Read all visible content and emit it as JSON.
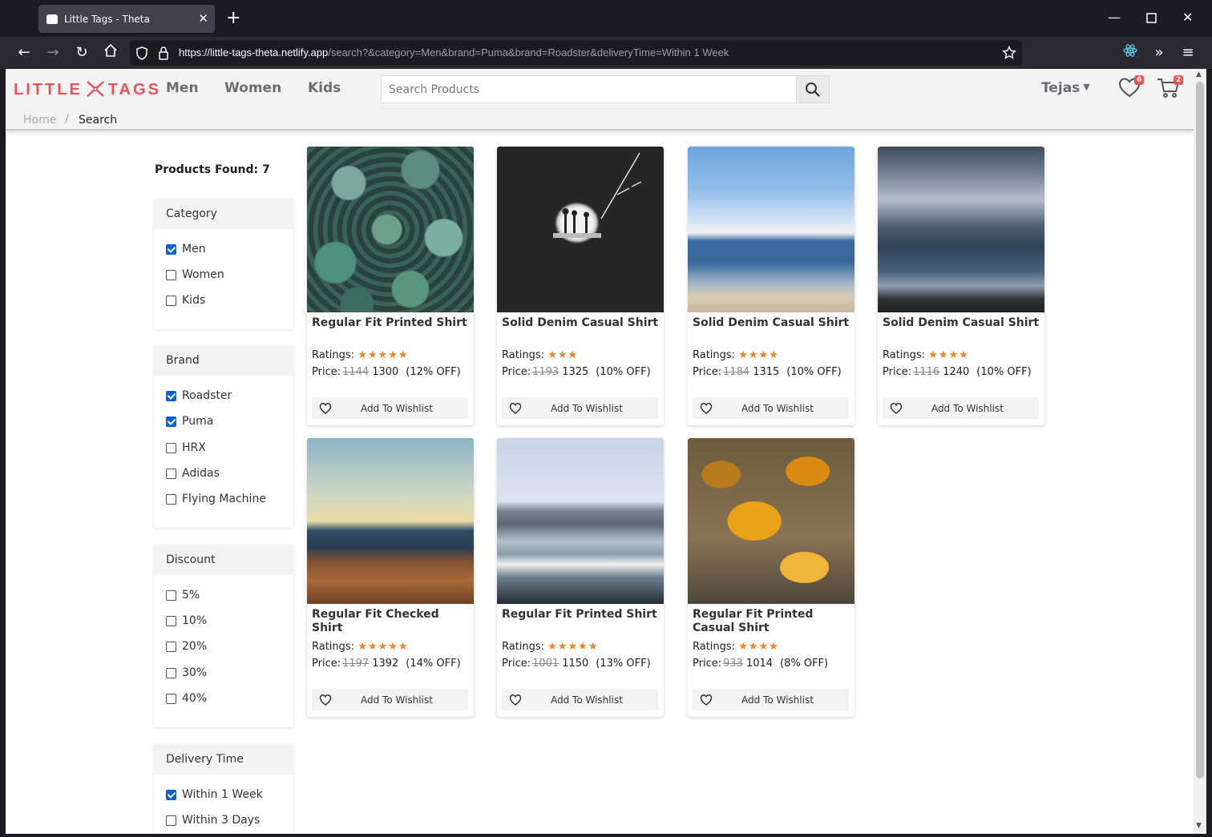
{
  "browser": {
    "tab_title": "Little Tags - Theta",
    "url_host": "https://little-tags-theta.netlify.app",
    "url_path": "/search?&category=Men&brand=Puma&brand=Roadster&deliveryTime=Within 1 Week"
  },
  "header": {
    "logo_left": "LITTLE",
    "logo_right": "TAGS",
    "nav": [
      "Men",
      "Women",
      "Kids"
    ],
    "search_placeholder": "Search Products",
    "user": "Tejas",
    "wishlist_count": "6",
    "cart_count": "2"
  },
  "breadcrumb": {
    "home": "Home",
    "separator": "/",
    "current": "Search"
  },
  "products_found": "Products Found: 7",
  "filters": {
    "category": {
      "title": "Category",
      "items": [
        {
          "label": "Men",
          "checked": true
        },
        {
          "label": "Women",
          "checked": false
        },
        {
          "label": "Kids",
          "checked": false
        }
      ]
    },
    "brand": {
      "title": "Brand",
      "items": [
        {
          "label": "Roadster",
          "checked": true
        },
        {
          "label": "Puma",
          "checked": true
        },
        {
          "label": "HRX",
          "checked": false
        },
        {
          "label": "Adidas",
          "checked": false
        },
        {
          "label": "Flying Machine",
          "checked": false
        }
      ]
    },
    "discount": {
      "title": "Discount",
      "items": [
        {
          "label": "5%",
          "checked": false
        },
        {
          "label": "10%",
          "checked": false
        },
        {
          "label": "20%",
          "checked": false
        },
        {
          "label": "30%",
          "checked": false
        },
        {
          "label": "40%",
          "checked": false
        }
      ]
    },
    "delivery": {
      "title": "Delivery Time",
      "items": [
        {
          "label": "Within 1 Week",
          "checked": true
        },
        {
          "label": "Within 3 Days",
          "checked": false
        }
      ]
    }
  },
  "ratings_label": "Ratings:",
  "price_label": "Price:",
  "wishlist_label": "Add To Wishlist",
  "products": [
    {
      "name": "Regular Fit Printed Shirt",
      "stars": 5,
      "old": "1144",
      "price": "1300",
      "off": "(12% OFF)",
      "image": "succulents"
    },
    {
      "name": "Solid Denim Casual Shirt",
      "stars": 3,
      "old": "1193",
      "price": "1325",
      "off": "(10% OFF)",
      "image": "cave-silhouettes"
    },
    {
      "name": "Solid Denim Casual Shirt",
      "stars": 4,
      "old": "1184",
      "price": "1315",
      "off": "(10% OFF)",
      "image": "beach-sky"
    },
    {
      "name": "Solid Denim Casual Shirt",
      "stars": 4,
      "old": "1116",
      "price": "1240",
      "off": "(10% OFF)",
      "image": "grey-sea"
    },
    {
      "name": "Regular Fit Checked Shirt",
      "stars": 5,
      "old": "1197",
      "price": "1392",
      "off": "(14% OFF)",
      "image": "lighthouse-shore"
    },
    {
      "name": "Regular Fit Printed Shirt",
      "stars": 5,
      "old": "1001",
      "price": "1150",
      "off": "(13% OFF)",
      "image": "golden-gate-beach"
    },
    {
      "name": "Regular Fit Printed Casual Shirt",
      "stars": 4,
      "old": "933",
      "price": "1014",
      "off": "(8% OFF)",
      "image": "autumn-leaves"
    }
  ],
  "colors": {
    "brand": "#e8535c",
    "star": "#f38121",
    "checkbox": "#0a63d0"
  }
}
